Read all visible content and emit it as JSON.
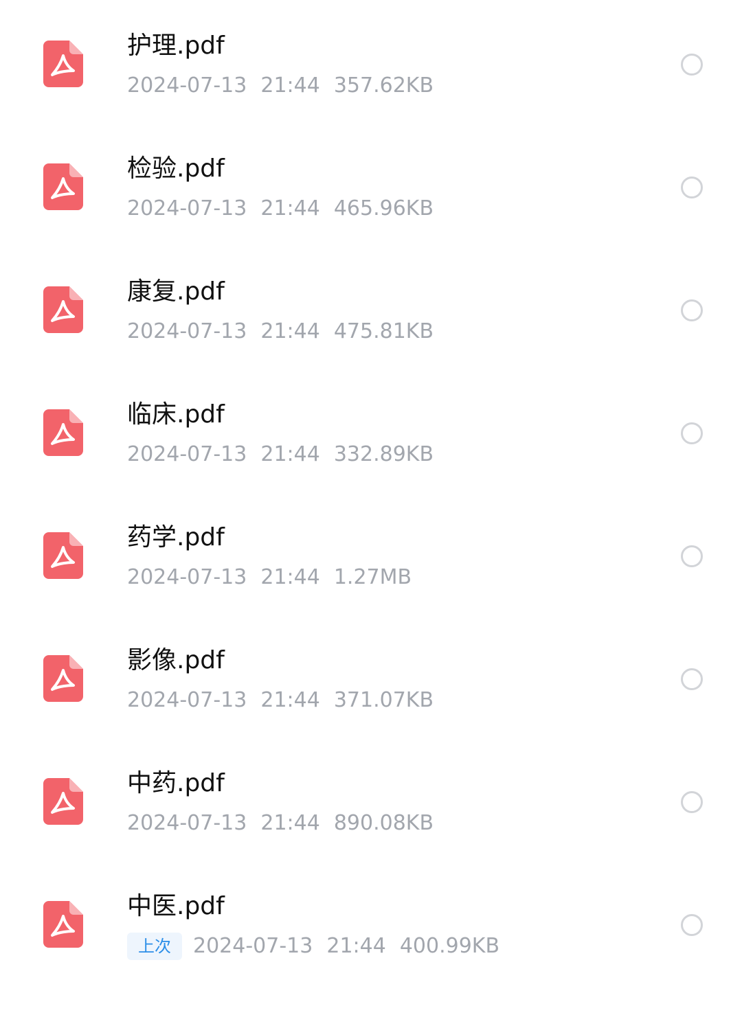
{
  "colors": {
    "pdf_icon": "#f2636a",
    "meta_text": "#a2a6ad",
    "badge_text": "#2b8ee8",
    "badge_bg": "#eef5fd"
  },
  "files": [
    {
      "name": "护理.pdf",
      "date": "2024-07-13",
      "time": "21:44",
      "size": "357.62KB",
      "icon": "pdf-icon",
      "selected": false
    },
    {
      "name": "检验.pdf",
      "date": "2024-07-13",
      "time": "21:44",
      "size": "465.96KB",
      "icon": "pdf-icon",
      "selected": false
    },
    {
      "name": "康复.pdf",
      "date": "2024-07-13",
      "time": "21:44",
      "size": "475.81KB",
      "icon": "pdf-icon",
      "selected": false
    },
    {
      "name": "临床.pdf",
      "date": "2024-07-13",
      "time": "21:44",
      "size": "332.89KB",
      "icon": "pdf-icon",
      "selected": false
    },
    {
      "name": "药学.pdf",
      "date": "2024-07-13",
      "time": "21:44",
      "size": "1.27MB",
      "icon": "pdf-icon",
      "selected": false
    },
    {
      "name": "影像.pdf",
      "date": "2024-07-13",
      "time": "21:44",
      "size": "371.07KB",
      "icon": "pdf-icon",
      "selected": false
    },
    {
      "name": "中药.pdf",
      "date": "2024-07-13",
      "time": "21:44",
      "size": "890.08KB",
      "icon": "pdf-icon",
      "selected": false
    },
    {
      "name": "中医.pdf",
      "badge": "上次",
      "date": "2024-07-13",
      "time": "21:44",
      "size": "400.99KB",
      "icon": "pdf-icon",
      "selected": false
    }
  ]
}
